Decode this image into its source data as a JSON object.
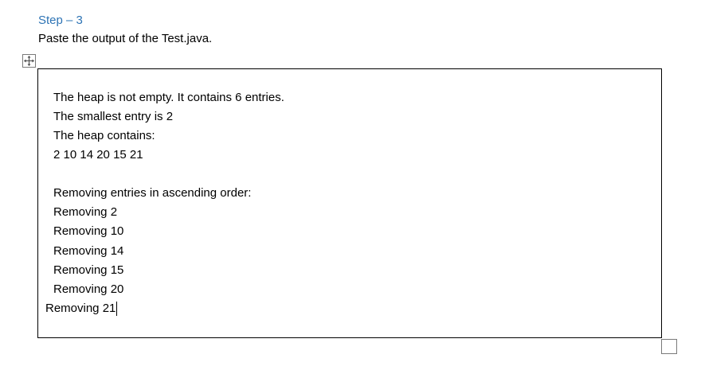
{
  "document": {
    "step_heading": "Step – 3",
    "instruction": "Paste the output of the Test.java.",
    "heading_color": "#2e74b5"
  },
  "table": {
    "move_handle_icon": "four-way-arrow-icon",
    "resize_handle_icon": "square-resize-icon",
    "output_lines": [
      "The heap is not empty. It contains 6 entries.",
      "The smallest entry is 2",
      "The heap contains:",
      "2 10 14 20 15 21",
      "",
      "Removing entries in ascending order:",
      "Removing 2",
      "Removing 10",
      "Removing 14",
      "Removing 15",
      "Removing 20",
      "Removing 21"
    ]
  }
}
